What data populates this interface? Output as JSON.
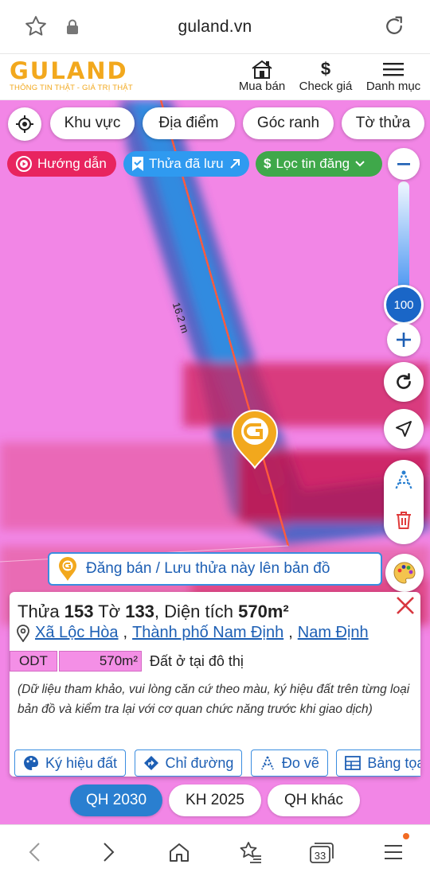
{
  "browser": {
    "url": "guland.vn",
    "tab_count": "33"
  },
  "header": {
    "brand": "GULAND",
    "tagline": "THÔNG TIN THẬT - GIÁ TRỊ THẬT",
    "buy_sell_label": "Mua bán",
    "check_price_label": "Check giá",
    "menu_label": "Danh mục"
  },
  "chips": {
    "area": "Khu vực",
    "place": "Địa điểm",
    "corner": "Góc ranh",
    "sheet": "Tờ thửa"
  },
  "pills": {
    "guide": "Hướng dẫn",
    "saved": "Thửa đã lưu",
    "filter": "Lọc tin đăng"
  },
  "zoom": {
    "level": "100"
  },
  "map": {
    "distance_label": "16.2 m",
    "post_banner": "Đăng bán / Lưu thửa này lên bản đồ"
  },
  "parcel": {
    "parcel_label": "Thửa",
    "parcel_no": "153",
    "sheet_label": "Tờ",
    "sheet_no": "133",
    "area_label": "Diện tích",
    "area": "570m²",
    "commune": "Xã Lộc Hòa",
    "city": "Thành phố Nam Định",
    "province": "Nam Định",
    "zone_code": "ODT",
    "zone_area": "570m²",
    "zone_desc": "Đất ở tại đô thị",
    "note": "(Dữ liệu tham khảo, vui lòng căn cứ theo màu, ký hiệu đất trên từng loại bản đồ và kiểm tra lại với cơ quan chức năng trước khi giao dịch)",
    "actions": [
      "Ký hiệu đất",
      "Chỉ đường",
      "Đo vẽ",
      "Bảng tọa độ"
    ]
  },
  "plans": {
    "qh2030": "QH 2030",
    "kh2025": "KH 2025",
    "other": "QH khác"
  },
  "colors": {
    "land_odt": "#f286e6",
    "accent_blue": "#2a7fd0",
    "brand_orange": "#f2a81d"
  }
}
